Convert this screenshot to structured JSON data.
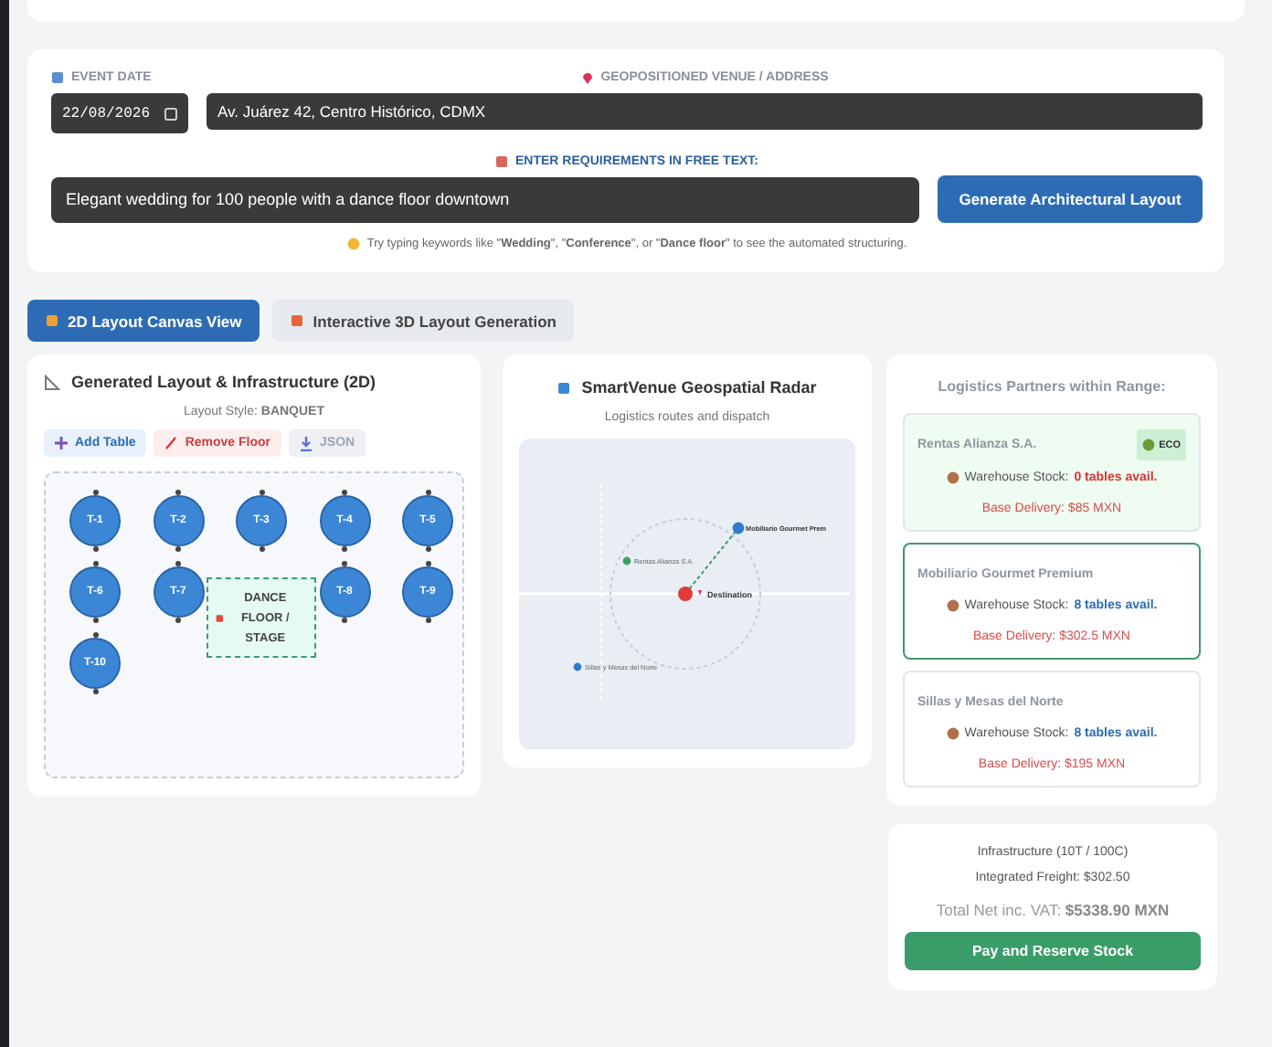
{
  "form": {
    "date_label": "EVENT DATE",
    "date_value": "22/08/2026",
    "address_label": "GEOPOSITIONED VENUE / ADDRESS",
    "address_value": "Av. Juárez 42, Centro Histórico, CDMX",
    "requirements_label": "ENTER REQUIREMENTS IN FREE TEXT:",
    "requirements_value": "Elegant wedding for 100 people with a dance floor downtown",
    "generate_button": "Generate Architectural Layout",
    "hint": "Try typing keywords like \"**Wedding**\", \"**Conference**\", or \"**Dance floor**\" to see the automated structuring."
  },
  "tabs": [
    {
      "label": "2D Layout Canvas View",
      "selected": true
    },
    {
      "label": "Interactive 3D Layout Generation",
      "selected": false
    }
  ],
  "layout_panel": {
    "title": "Generated Layout & Infrastructure (2D)",
    "style_label": "Layout Style:",
    "style_value": "BANQUET",
    "actions": [
      {
        "kind": "add",
        "label": "Add Table",
        "disabled": false
      },
      {
        "kind": "remove",
        "label": "Remove Floor",
        "disabled": false
      },
      {
        "kind": "export",
        "label": "JSON",
        "disabled": true
      }
    ],
    "tables": [
      "T-1",
      "T-2",
      "T-3",
      "T-4",
      "T-5",
      "T-6",
      "T-7",
      "T-8",
      "T-9",
      "T-10"
    ],
    "dance_floor": "DANCE FLOOR / STAGE"
  },
  "radar_panel": {
    "title": "SmartVenue Geospatial Radar",
    "subtitle": "Logistics routes and dispatch",
    "destination": "Destination",
    "points": [
      {
        "label": "Mobiliario Gourmet Prem",
        "color": "#2f7bd0",
        "selected": true
      },
      {
        "label": "Rentas Alianza S.A.",
        "color": "#3aa35c",
        "selected": false
      },
      {
        "label": "Sillas y Mesas del Norte",
        "color": "#2f7bd0",
        "selected": false
      }
    ]
  },
  "partners_panel": {
    "title": "Logistics Partners within Range:",
    "partners": [
      {
        "name": "Rentas Alianza S.A.",
        "eco": true,
        "badge": "ECO",
        "selected": false,
        "stock_label": "Warehouse Stock:",
        "stock": "0 tables avail.",
        "in_stock": false,
        "delivery": "Base Delivery: $85 MXN"
      },
      {
        "name": "Mobiliario Gourmet Premium",
        "eco": false,
        "selected": true,
        "stock_label": "Warehouse Stock:",
        "stock": "8 tables avail.",
        "in_stock": true,
        "delivery": "Base Delivery: $302.5 MXN"
      },
      {
        "name": "Sillas y Mesas del Norte",
        "eco": false,
        "selected": false,
        "stock_label": "Warehouse Stock:",
        "stock": "8 tables avail.",
        "in_stock": true,
        "delivery": "Base Delivery: $195 MXN"
      }
    ]
  },
  "summary": {
    "infrastructure": "Infrastructure (10T / 100C)",
    "freight": "Integrated Freight: $302.50",
    "total": "Total Net inc. VAT: **$5338.90 MXN**",
    "pay_button": "Pay and Reserve Stock"
  }
}
